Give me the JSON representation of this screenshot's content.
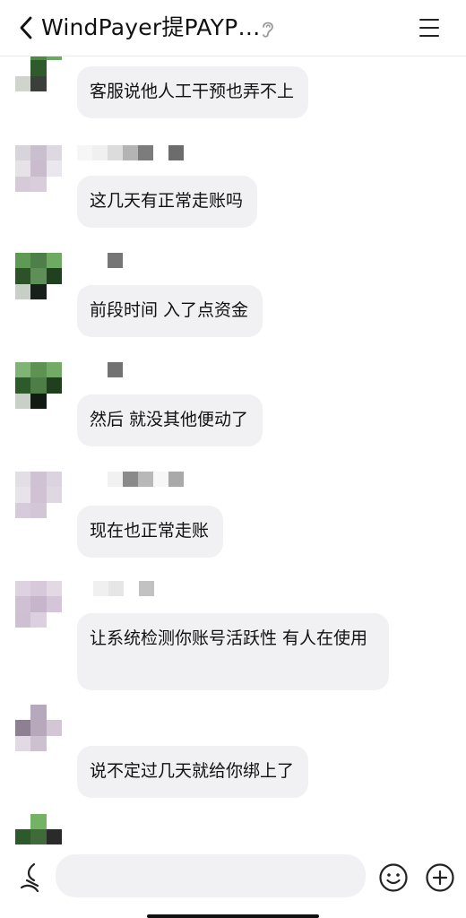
{
  "header": {
    "title": "WindPayer提PAYP…"
  },
  "messages": [
    {
      "text": "客服说他人工干预也弄不上"
    },
    {
      "text": "这几天有正常走账吗"
    },
    {
      "text": "前段时间 入了点资金"
    },
    {
      "text": "然后 就没其他便动了"
    },
    {
      "text": "现在也正常走账"
    },
    {
      "text": "让系统检测你账号活跃性  有人在使用"
    },
    {
      "text": "说不定过几天就给你绑上了"
    }
  ],
  "input": {
    "value": ""
  }
}
